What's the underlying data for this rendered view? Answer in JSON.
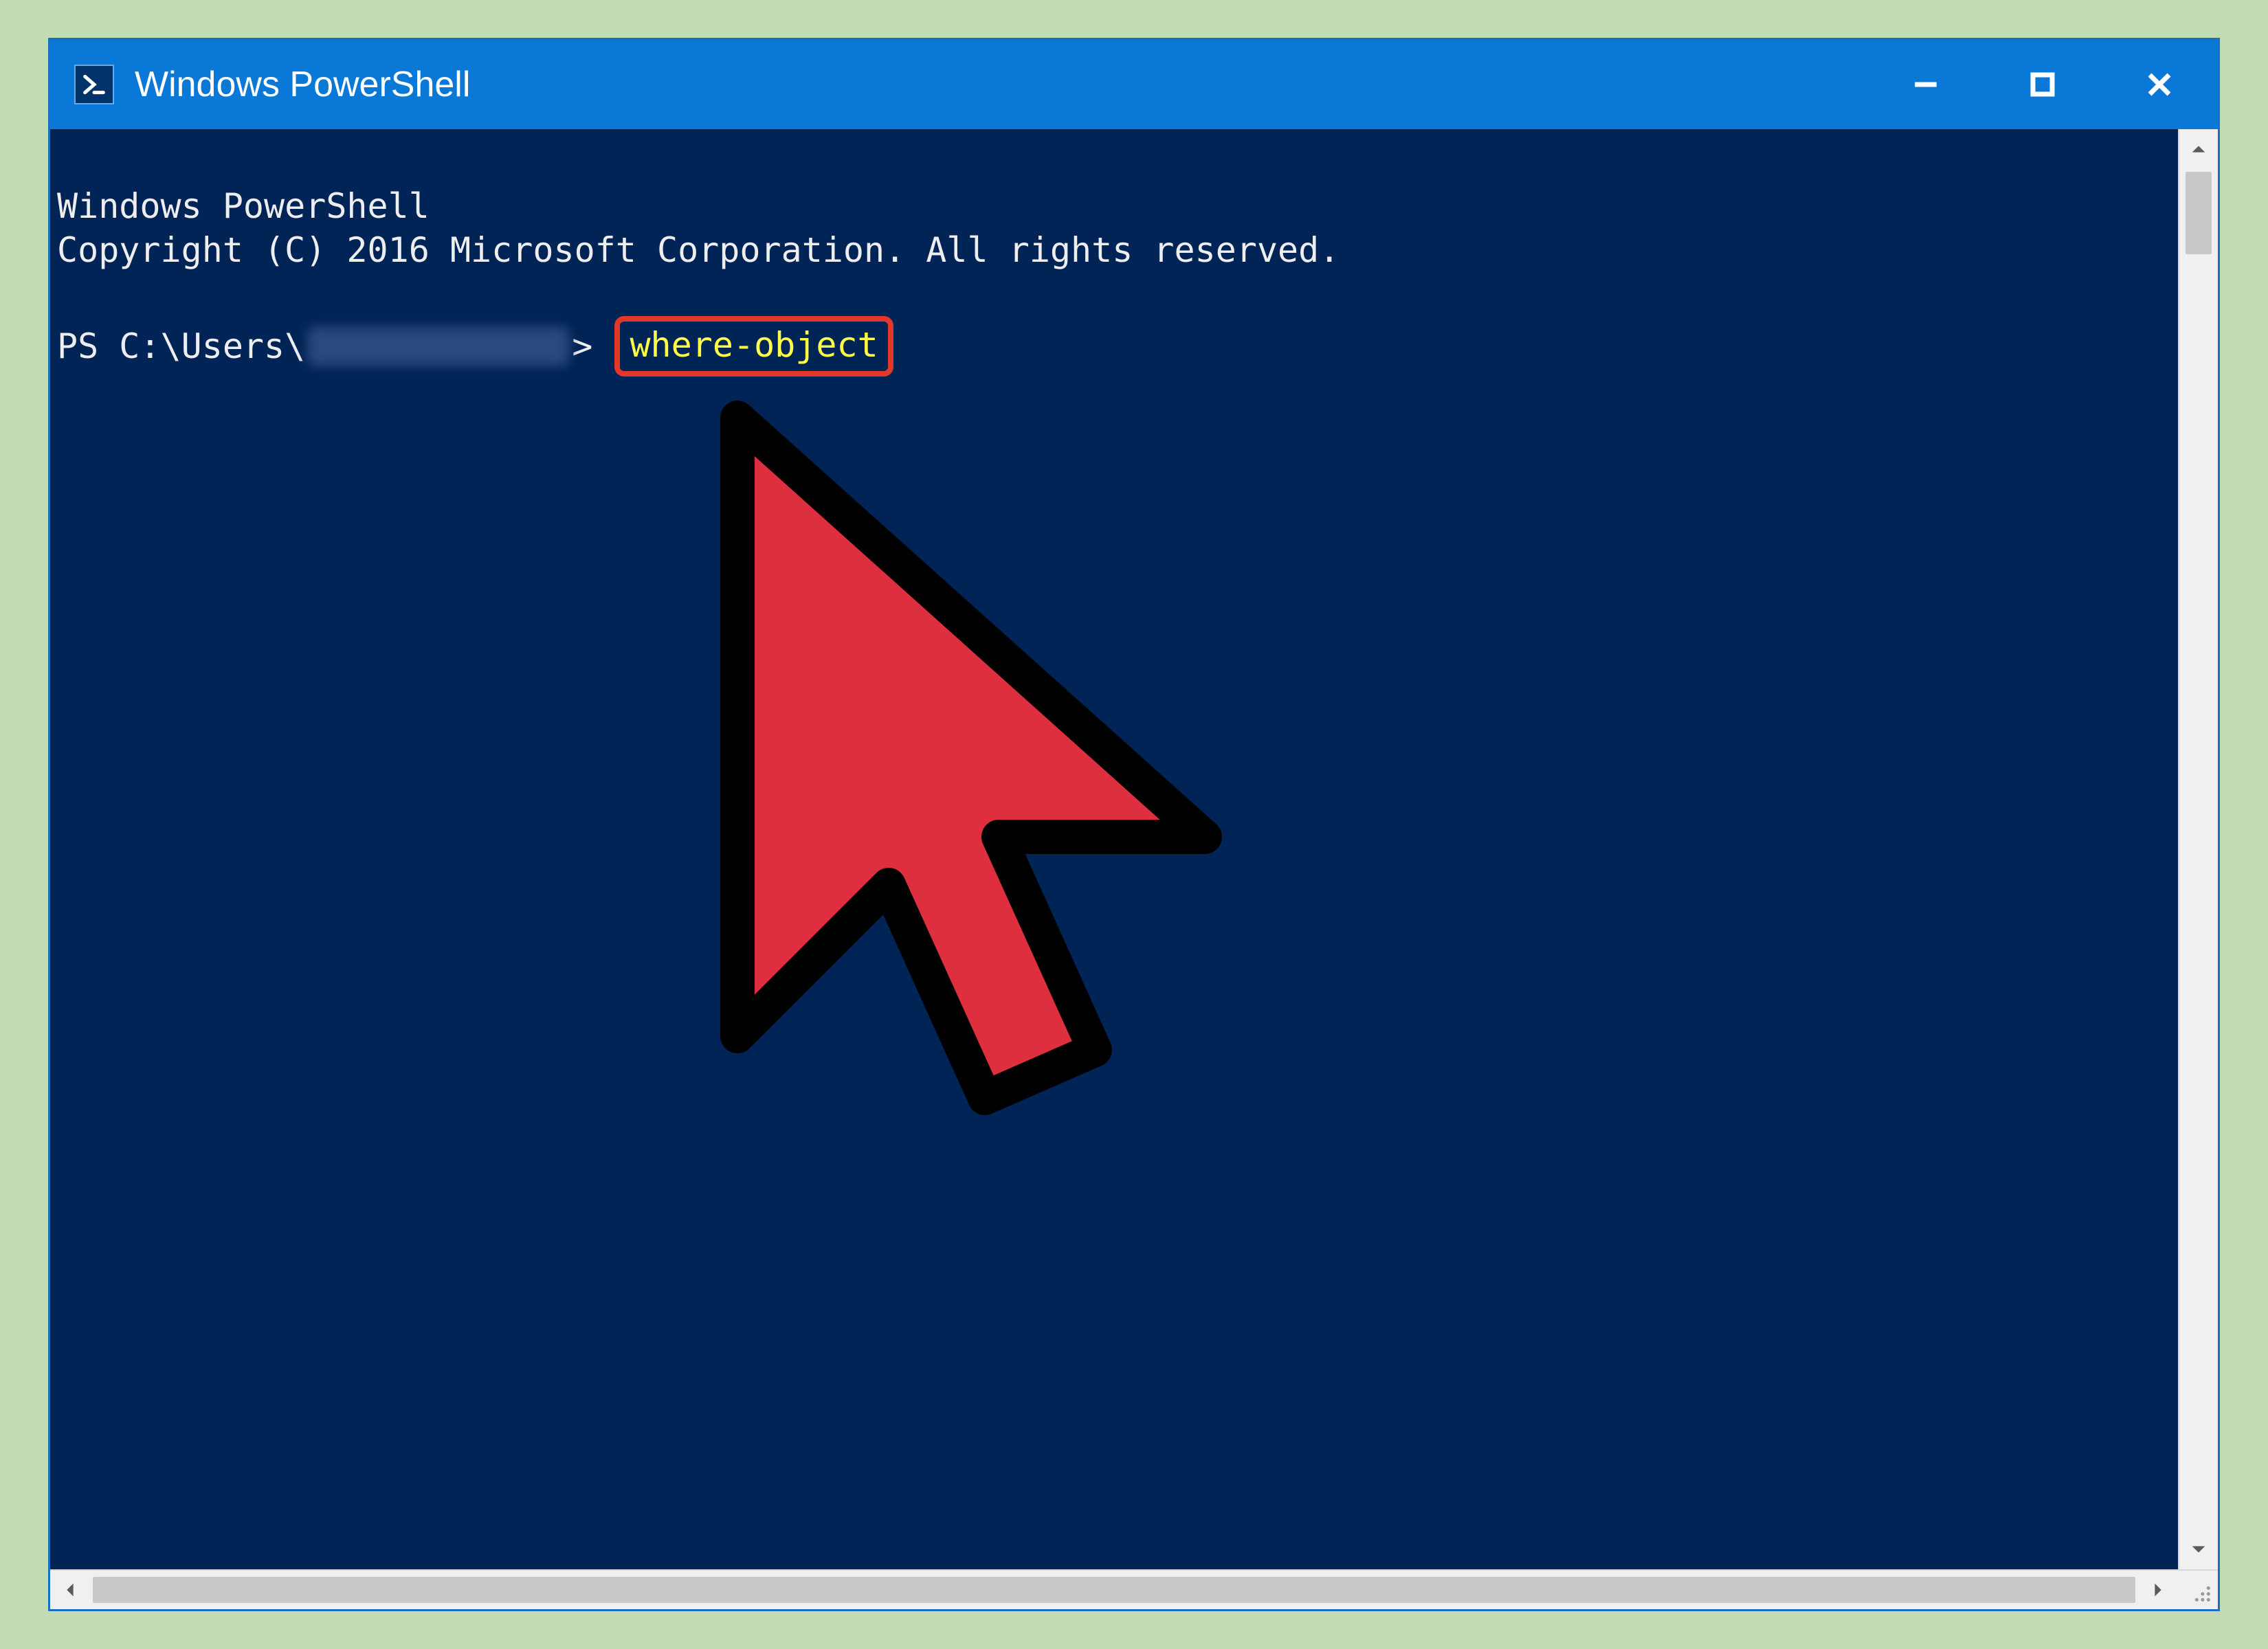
{
  "window": {
    "title": "Windows PowerShell"
  },
  "terminal": {
    "line1": "Windows PowerShell",
    "line2": "Copyright (C) 2016 Microsoft Corporation. All rights reserved.",
    "prompt_prefix": "PS C:\\Users\\",
    "prompt_suffix": "> ",
    "command": "where-object"
  }
}
